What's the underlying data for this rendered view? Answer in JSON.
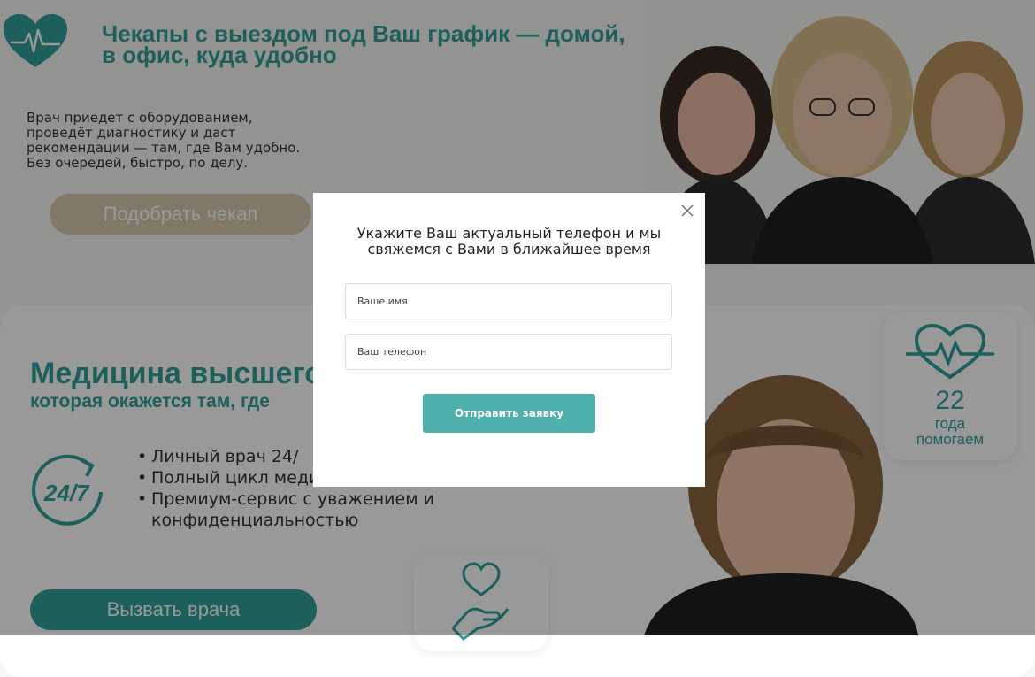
{
  "hero": {
    "title_line1": "Чекапы с выездом под Ваш график — домой,",
    "title_line2": "в офис, куда удобно",
    "text_line1": "Врач приедет с оборудованием,",
    "text_line2": "проведёт диагностику и даст",
    "text_line3": "рекомендации — там, где Вам удобно.",
    "text_line4": "Без очередей, быстро, по делу.",
    "button_label": "Подобрать чекап"
  },
  "section": {
    "title": "Медицина высшего",
    "subtitle": "которая окажется там, где",
    "bullets": [
      "Личный врач 24/",
      "Полный цикл медицинских услуг",
      "Премиум-сервис с уважением и конфиденциальностью"
    ],
    "call_button_label": "Вызвать врача",
    "years_number": "22",
    "years_label_line1": "года",
    "years_label_line2": "помогаем",
    "icon_247": "24-7-clock-icon",
    "icon_heart_pulse": "heart-pulse-icon",
    "icon_care": "heart-hand-icon"
  },
  "modal": {
    "title_line1": "Укажите Ваш актуальный телефон и мы",
    "title_line2": "свяжемся с Вами в ближайшее время",
    "name_placeholder": "Ваше имя",
    "phone_placeholder": "Ваш телефон",
    "submit_label": "Отправить заявку",
    "close_icon": "close-icon"
  },
  "colors": {
    "accent": "#2f9e98",
    "button_modal": "#4fb0ab",
    "button_beige": "#d8c9ac",
    "overlay": "rgba(0,0,0,0.40)"
  }
}
